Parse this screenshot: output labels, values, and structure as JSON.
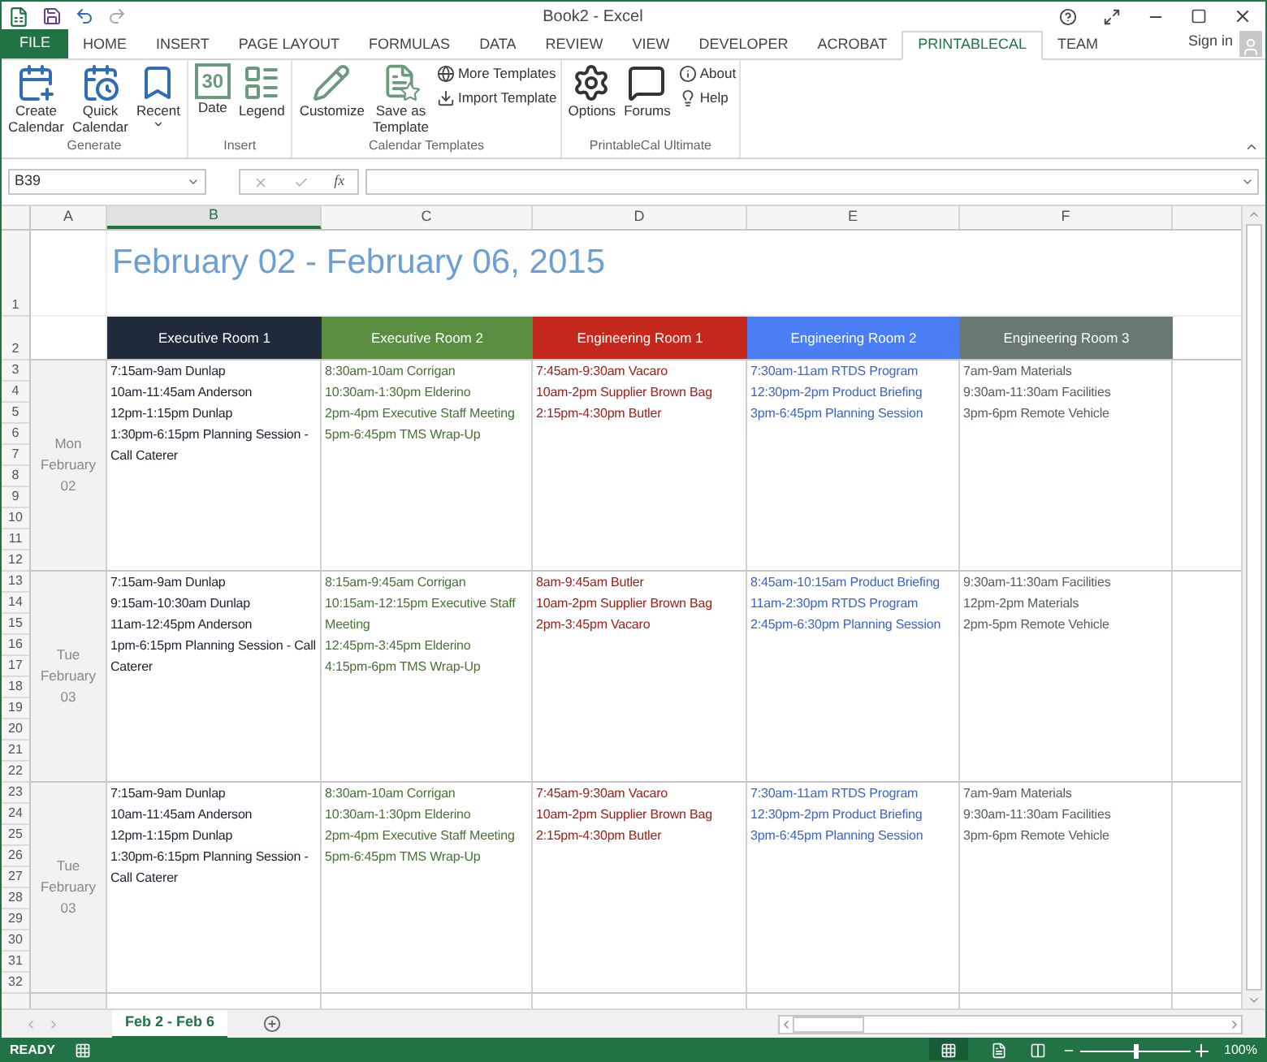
{
  "window": {
    "title": "Book2 - Excel",
    "sign_in": "Sign in"
  },
  "ribbon_tabs": [
    {
      "label": "FILE",
      "kind": "file",
      "selected": false
    },
    {
      "label": "HOME",
      "kind": "tab",
      "selected": false
    },
    {
      "label": "INSERT",
      "kind": "tab",
      "selected": false
    },
    {
      "label": "PAGE LAYOUT",
      "kind": "tab",
      "selected": false
    },
    {
      "label": "FORMULAS",
      "kind": "tab",
      "selected": false
    },
    {
      "label": "DATA",
      "kind": "tab",
      "selected": false
    },
    {
      "label": "REVIEW",
      "kind": "tab",
      "selected": false
    },
    {
      "label": "VIEW",
      "kind": "tab",
      "selected": false
    },
    {
      "label": "DEVELOPER",
      "kind": "tab",
      "selected": false
    },
    {
      "label": "ACROBAT",
      "kind": "tab",
      "selected": false
    },
    {
      "label": "PRINTABLECAL",
      "kind": "tab",
      "selected": true
    },
    {
      "label": "TEAM",
      "kind": "tab",
      "selected": false
    }
  ],
  "ribbon_groups": [
    {
      "label": "Generate",
      "large_buttons": [
        {
          "lines": [
            "Create",
            "Calendar"
          ],
          "dropdown": false
        },
        {
          "lines": [
            "Quick",
            "Calendar"
          ],
          "dropdown": false
        },
        {
          "lines": [
            "Recent"
          ],
          "dropdown": true
        }
      ]
    },
    {
      "label": "Insert",
      "large_buttons": [
        {
          "lines": [
            "Date"
          ],
          "dropdown": false,
          "icon_text": "30"
        },
        {
          "lines": [
            "Legend"
          ],
          "dropdown": false
        }
      ]
    },
    {
      "label": "Calendar Templates",
      "large_buttons": [
        {
          "lines": [
            "Customize"
          ],
          "dropdown": false
        },
        {
          "lines": [
            "Save as",
            "Template"
          ],
          "dropdown": false
        }
      ],
      "small_buttons": [
        "More Templates",
        "Import Template"
      ]
    },
    {
      "label": "PrintableCal Ultimate",
      "large_buttons": [
        {
          "lines": [
            "Options"
          ],
          "dropdown": false
        },
        {
          "lines": [
            "Forums"
          ],
          "dropdown": false
        }
      ],
      "small_buttons": [
        "About",
        "Help"
      ]
    }
  ],
  "formula_bar": {
    "name_box": "B39",
    "function_label": "fx"
  },
  "sheet": {
    "columns": [
      {
        "label": "A",
        "selected": false
      },
      {
        "label": "B",
        "selected": true
      },
      {
        "label": "C",
        "selected": false
      },
      {
        "label": "D",
        "selected": false
      },
      {
        "label": "E",
        "selected": false
      },
      {
        "label": "F",
        "selected": false
      }
    ],
    "row_numbers": [
      "1",
      "2",
      "3",
      "4",
      "5",
      "6",
      "7",
      "8",
      "9",
      "10",
      "11",
      "12",
      "13",
      "14",
      "15",
      "16",
      "17",
      "18",
      "19",
      "20",
      "21",
      "22",
      "23",
      "24",
      "25",
      "26",
      "27",
      "28",
      "29",
      "30",
      "31",
      "32"
    ],
    "title": "February 02 - February 06, 2015",
    "rooms": [
      {
        "name": "Executive Room 1",
        "color": "#1f2b3a"
      },
      {
        "name": "Executive Room 2",
        "color": "#5a8f42"
      },
      {
        "name": "Engineering Room 1",
        "color": "#c5291d"
      },
      {
        "name": "Engineering Room 2",
        "color": "#4a7ef5"
      },
      {
        "name": "Engineering Room 3",
        "color": "#687873"
      }
    ],
    "days": [
      {
        "weekday": "Mon",
        "month": "February",
        "day": "02",
        "events": [
          [
            "7:15am-9am Dunlap",
            "10am-11:45am Anderson",
            "12pm-1:15pm Dunlap",
            "1:30pm-6:15pm Planning Session - Call Caterer"
          ],
          [
            "8:30am-10am Corrigan",
            "10:30am-1:30pm Elderino",
            "2pm-4pm Executive Staff Meeting",
            "5pm-6:45pm TMS Wrap-Up"
          ],
          [
            "7:45am-9:30am Vacaro",
            "10am-2pm Supplier Brown Bag",
            "2:15pm-4:30pm Butler"
          ],
          [
            "7:30am-11am RTDS Program",
            "12:30pm-2pm Product Briefing",
            "3pm-6:45pm Planning Session"
          ],
          [
            "7am-9am Materials",
            "9:30am-11:30am Facilities",
            "3pm-6pm Remote Vehicle"
          ]
        ]
      },
      {
        "weekday": "Tue",
        "month": "February",
        "day": "03",
        "events": [
          [
            "7:15am-9am Dunlap",
            "9:15am-10:30am Dunlap",
            "11am-12:45pm Anderson",
            "1pm-6:15pm Planning Session - Call Caterer"
          ],
          [
            "8:15am-9:45am Corrigan",
            "10:15am-12:15pm Executive Staff Meeting",
            "12:45pm-3:45pm Elderino",
            "4:15pm-6pm TMS Wrap-Up"
          ],
          [
            "8am-9:45am Butler",
            "10am-2pm Supplier Brown Bag",
            "2pm-3:45pm Vacaro"
          ],
          [
            "8:45am-10:15am Product Briefing",
            "11am-2:30pm RTDS Program",
            "2:45pm-6:30pm Planning Session"
          ],
          [
            "9:30am-11:30am Facilities",
            "12pm-2pm Materials",
            "2pm-5pm Remote Vehicle"
          ]
        ]
      },
      {
        "weekday": "Tue",
        "month": "February",
        "day": "03",
        "events": [
          [
            "7:15am-9am Dunlap",
            "10am-11:45am Anderson",
            "12pm-1:15pm Dunlap",
            "1:30pm-6:15pm Planning Session - Call Caterer"
          ],
          [
            "8:30am-10am Corrigan",
            "10:30am-1:30pm Elderino",
            "2pm-4pm Executive Staff Meeting",
            "5pm-6:45pm TMS Wrap-Up"
          ],
          [
            "7:45am-9:30am Vacaro",
            "10am-2pm Supplier Brown Bag",
            "2:15pm-4:30pm Butler"
          ],
          [
            "7:30am-11am RTDS Program",
            "12:30pm-2pm Product Briefing",
            "3pm-6:45pm Planning Session"
          ],
          [
            "7am-9am Materials",
            "9:30am-11:30am Facilities",
            "3pm-6pm Remote Vehicle"
          ]
        ]
      }
    ]
  },
  "sheet_tabs": [
    {
      "label": "Feb 2 - Feb 6",
      "selected": true
    }
  ],
  "status_bar": {
    "mode": "READY",
    "zoom": {
      "level": 0.5,
      "reading": "100%"
    }
  }
}
